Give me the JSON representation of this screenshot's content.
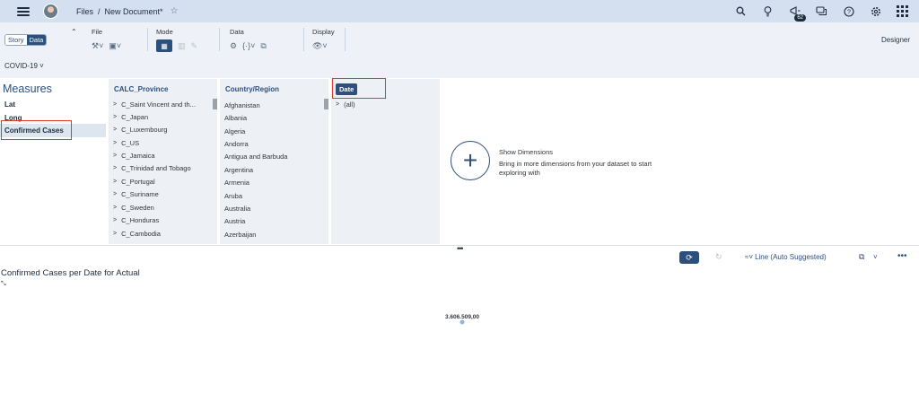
{
  "shell": {
    "breadcrumb_files": "Files",
    "breadcrumb_sep": "/",
    "document_title": "New Document*",
    "notification_count": "62",
    "icons": [
      "search-icon",
      "lightbulb-icon",
      "megaphone-icon",
      "chat-icon",
      "help-icon",
      "settings-icon",
      "apps-grid-icon"
    ]
  },
  "toolbar": {
    "story_label": "Story",
    "data_label": "Data",
    "file_label": "File",
    "mode_label": "Mode",
    "data_group_label": "Data",
    "display_label": "Display",
    "designer_label": "Designer"
  },
  "model": {
    "name": "COVID-19"
  },
  "measures": {
    "title": "Measures",
    "items": [
      "Lat",
      "Long",
      "Confirmed Cases"
    ],
    "selected": "Confirmed Cases"
  },
  "calc_province": {
    "header": "CALC_Province",
    "items": [
      "C_Saint Vincent and th...",
      "C_Japan",
      "C_Luxembourg",
      "C_US",
      "C_Jamaica",
      "C_Trinidad and Tobago",
      "C_Portugal",
      "C_Suriname",
      "C_Sweden",
      "C_Honduras",
      "C_Cambodia"
    ]
  },
  "country_region": {
    "header": "Country/Region",
    "items": [
      "Afghanistan",
      "Albania",
      "Algeria",
      "Andorra",
      "Antigua and Barbuda",
      "Argentina",
      "Armenia",
      "Aruba",
      "Australia",
      "Austria",
      "Azerbaijan"
    ]
  },
  "date_panel": {
    "header": "Date",
    "items": [
      "(all)"
    ]
  },
  "show_dimensions": {
    "title": "Show Dimensions",
    "text": "Bring in more dimensions from your dataset to start exploring with"
  },
  "chart_toolbar": {
    "chart_type_label": "Line (Auto Suggested)"
  },
  "chart_data": {
    "type": "line",
    "title": "Confirmed Cases per Date for Actual",
    "series": [
      {
        "values": [
          3606509.0
        ]
      }
    ],
    "data_labels": [
      "3.606.509,00"
    ],
    "colors": {
      "point": "#8fb4e3"
    }
  }
}
